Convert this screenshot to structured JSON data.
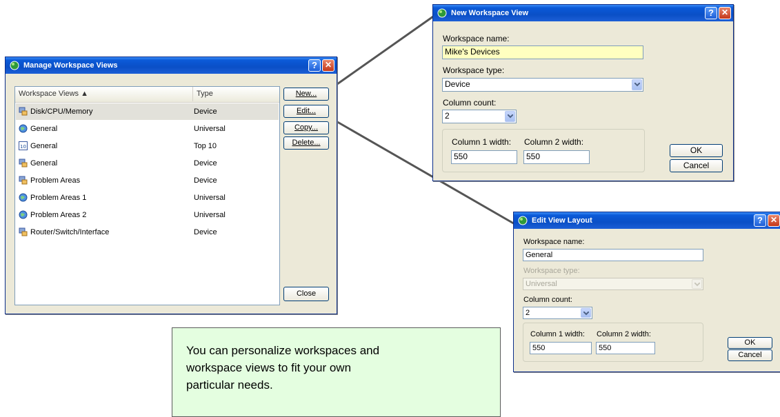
{
  "manage_dialog": {
    "title": "Manage Workspace Views",
    "columns": [
      "Workspace Views ▲",
      "Type"
    ],
    "rows": [
      {
        "name": "Disk/CPU/Memory",
        "type": "Device",
        "icon": "device-icon"
      },
      {
        "name": "General",
        "type": "Universal",
        "icon": "globe-icon"
      },
      {
        "name": "General",
        "type": "Top 10",
        "icon": "top10-icon"
      },
      {
        "name": "General",
        "type": "Device",
        "icon": "device-icon"
      },
      {
        "name": "Problem Areas",
        "type": "Device",
        "icon": "device-icon"
      },
      {
        "name": "Problem Areas 1",
        "type": "Universal",
        "icon": "globe-icon"
      },
      {
        "name": "Problem Areas 2",
        "type": "Universal",
        "icon": "globe-icon"
      },
      {
        "name": "Router/Switch/Interface",
        "type": "Device",
        "icon": "device-icon"
      }
    ],
    "buttons": {
      "new": "New...",
      "edit": "Edit...",
      "copy": "Copy...",
      "delete": "Delete...",
      "close": "Close"
    }
  },
  "new_dialog": {
    "title": "New Workspace View",
    "name_label": "Workspace name:",
    "name_value": "Mike's Devices",
    "type_label": "Workspace type:",
    "type_value": "Device",
    "count_label": "Column count:",
    "count_value": "2",
    "col1_label": "Column 1 width:",
    "col1_value": "550",
    "col2_label": "Column 2 width:",
    "col2_value": "550",
    "ok": "OK",
    "cancel": "Cancel"
  },
  "edit_dialog": {
    "title": "Edit View Layout",
    "name_label": "Workspace name:",
    "name_value": "General",
    "type_label": "Workspace type:",
    "type_value": "Universal",
    "count_label": "Column count:",
    "count_value": "2",
    "col1_label": "Column 1 width:",
    "col1_value": "550",
    "col2_label": "Column 2 width:",
    "col2_value": "550",
    "ok": "OK",
    "cancel": "Cancel"
  },
  "note_text": "You can personalize workspaces and\nworkspace views to fit your own\nparticular needs.",
  "colors": {
    "title_bar": "#0a4fc6",
    "dialog_bg": "#ece9d8",
    "highlight_input": "#ffffc0",
    "note_bg": "#e4fee0"
  }
}
